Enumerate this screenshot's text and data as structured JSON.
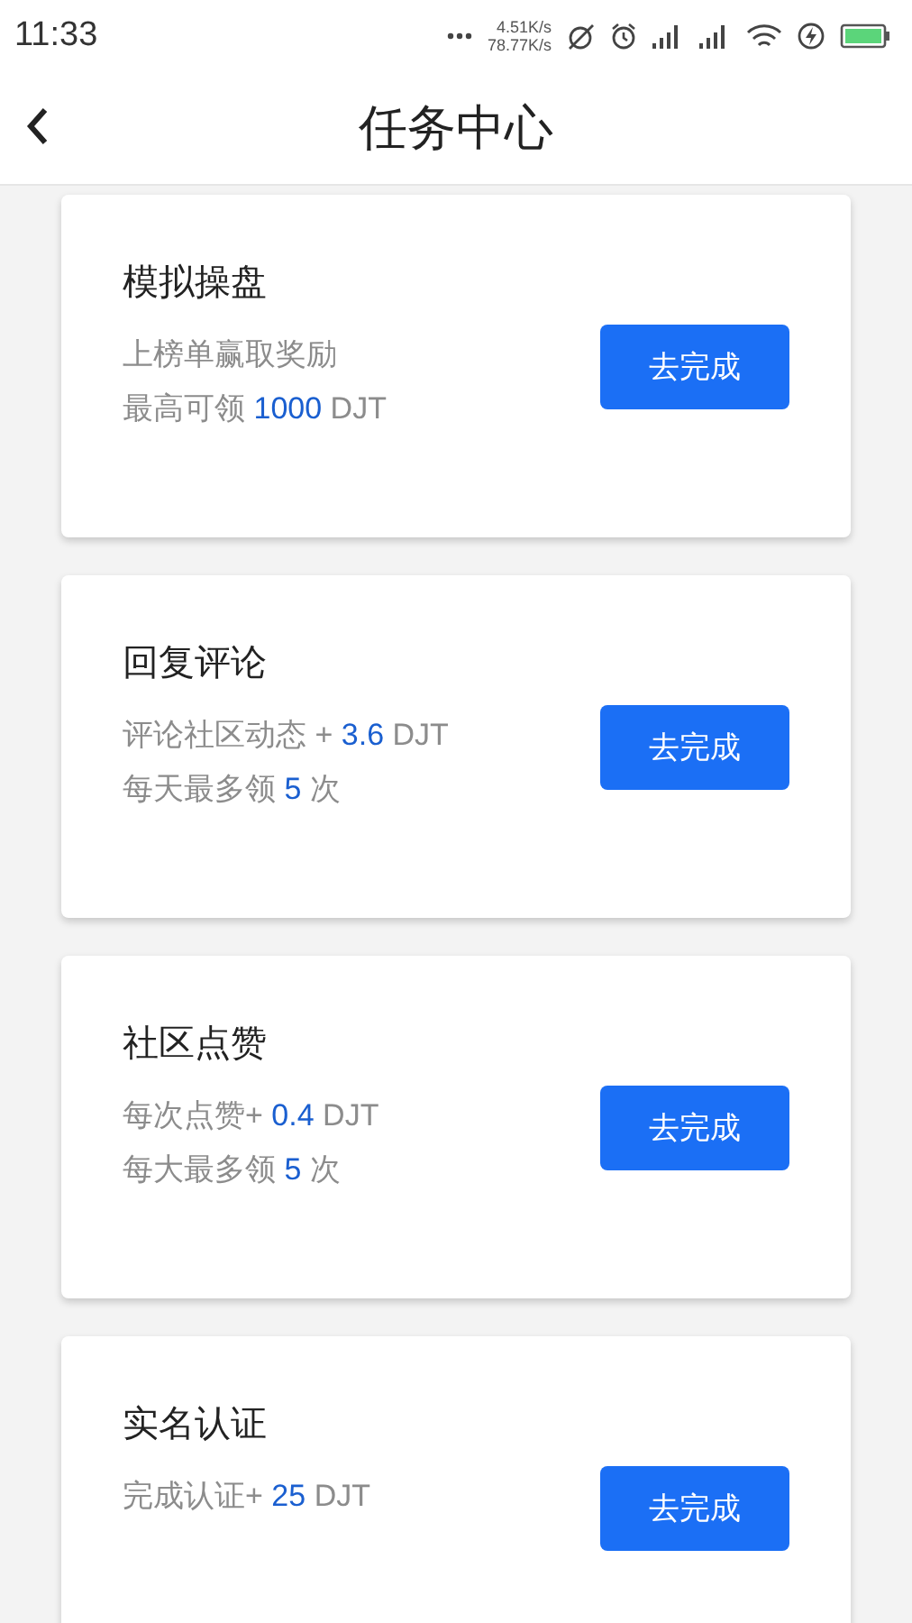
{
  "status_bar": {
    "time": "11:33",
    "speed_up": "4.51K/s",
    "speed_down": "78.77K/s"
  },
  "header": {
    "title": "任务中心"
  },
  "tasks": [
    {
      "title": "模拟操盘",
      "lines": [
        [
          {
            "text": "上榜单赢取奖励",
            "accent": false
          }
        ],
        [
          {
            "text": "最高可领",
            "accent": false
          },
          {
            "text": "1000",
            "accent": true
          },
          {
            "text": "DJT",
            "accent": false
          }
        ]
      ],
      "button": "去完成"
    },
    {
      "title": "回复评论",
      "lines": [
        [
          {
            "text": "评论社区动态 +",
            "accent": false
          },
          {
            "text": "3.6",
            "accent": true
          },
          {
            "text": "DJT",
            "accent": false
          }
        ],
        [
          {
            "text": "每天最多领",
            "accent": false
          },
          {
            "text": "5",
            "accent": true
          },
          {
            "text": "次",
            "accent": false
          }
        ]
      ],
      "button": "去完成"
    },
    {
      "title": "社区点赞",
      "lines": [
        [
          {
            "text": "每次点赞+",
            "accent": false
          },
          {
            "text": "0.4",
            "accent": true
          },
          {
            "text": "DJT",
            "accent": false
          }
        ],
        [
          {
            "text": "每大最多领",
            "accent": false
          },
          {
            "text": "5",
            "accent": true
          },
          {
            "text": "次",
            "accent": false
          }
        ]
      ],
      "button": "去完成"
    },
    {
      "title": "实名认证",
      "lines": [
        [
          {
            "text": "完成认证+",
            "accent": false
          },
          {
            "text": "25",
            "accent": true
          },
          {
            "text": "DJT",
            "accent": false
          }
        ]
      ],
      "button": "去完成"
    }
  ]
}
